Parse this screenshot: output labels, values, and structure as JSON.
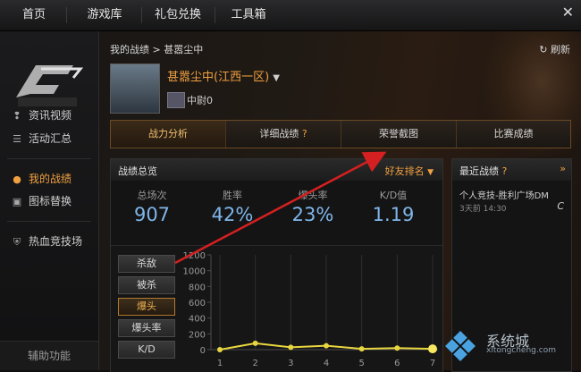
{
  "topnav": {
    "tabs": [
      "首页",
      "游戏库",
      "礼包兑换",
      "工具箱"
    ],
    "close": "✕"
  },
  "sidebar": {
    "items": [
      {
        "label": "资讯视频",
        "icon": "info-icon",
        "active": false
      },
      {
        "label": "活动汇总",
        "icon": "list-icon",
        "active": false
      },
      {
        "label": "我的战绩",
        "icon": "user-icon",
        "active": true
      },
      {
        "label": "图标替换",
        "icon": "replace-icon",
        "active": false
      },
      {
        "label": "热血竞技场",
        "icon": "shield-icon",
        "active": false
      }
    ],
    "assist": "辅助功能"
  },
  "main": {
    "breadcrumb": "我的战绩 > 甚嚣尘中",
    "refresh": "刷新",
    "player_name": "甚嚣尘中(江西一区)",
    "rank": "中尉0",
    "subtabs": [
      "战力分析",
      "详细战绩",
      "荣誉截图",
      "比赛成绩"
    ],
    "overview_title": "战绩总览",
    "sort_label": "好友排名",
    "stats": [
      {
        "label": "总场次",
        "value": "907"
      },
      {
        "label": "胜率",
        "value": "42%"
      },
      {
        "label": "爆头率",
        "value": "23%"
      },
      {
        "label": "K/D值",
        "value": "1.19"
      }
    ],
    "chart_buttons": [
      "杀敌",
      "被杀",
      "爆头",
      "爆头率",
      "K/D"
    ],
    "recent_title": "最近战绩",
    "recent_item": "个人竞技-胜利广场DM",
    "recent_time": "3天前 14:30",
    "recent_result": "C"
  },
  "watermark": {
    "title": "系统城",
    "sub": "xitongcheng.com"
  },
  "colors": {
    "accent": "#f0a040",
    "value_blue": "#7fb6ea",
    "line": "#e8d640",
    "arrow": "#d42020"
  },
  "chart_data": {
    "type": "line",
    "x": [
      1,
      2,
      3,
      4,
      5,
      6,
      7
    ],
    "y": [
      0,
      80,
      30,
      50,
      10,
      20,
      10
    ],
    "yticks": [
      0,
      200,
      400,
      600,
      800,
      1000,
      1200
    ],
    "ylim": [
      0,
      1200
    ],
    "xticks": [
      "1",
      "2",
      "3",
      "4",
      "5",
      "6",
      "7"
    ]
  }
}
